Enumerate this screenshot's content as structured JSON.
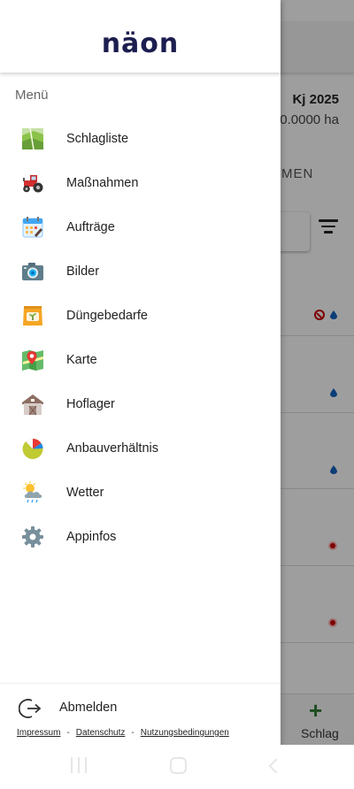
{
  "background": {
    "year": "Kj 2025",
    "area": "0.0000 ha",
    "tab_partial": "MEN",
    "add_button_label": "Schlag"
  },
  "drawer": {
    "logo_text": "näon",
    "menu_title": "Menü",
    "items": [
      {
        "label": "Schlagliste",
        "icon": "field-map-icon"
      },
      {
        "label": "Maßnahmen",
        "icon": "tractor-icon"
      },
      {
        "label": "Aufträge",
        "icon": "calendar-icon"
      },
      {
        "label": "Bilder",
        "icon": "camera-icon"
      },
      {
        "label": "Düngebedarfe",
        "icon": "fertilizer-bag-icon"
      },
      {
        "label": "Karte",
        "icon": "map-pin-icon"
      },
      {
        "label": "Hoflager",
        "icon": "barn-icon"
      },
      {
        "label": "Anbauverhältnis",
        "icon": "pie-chart-icon"
      },
      {
        "label": "Wetter",
        "icon": "weather-icon"
      },
      {
        "label": "Appinfos",
        "icon": "gear-icon"
      }
    ],
    "logout_label": "Abmelden",
    "footer_links": {
      "impressum": "Impressum",
      "datenschutz": "Datenschutz",
      "nutzungsbedingungen": "Nutzungsbedingungen",
      "separator": "-"
    }
  },
  "colors": {
    "logo": "#1c1e4f",
    "accent_green": "#2e7d32",
    "status_red": "#cc0000",
    "drop_blue": "#1565c0"
  }
}
